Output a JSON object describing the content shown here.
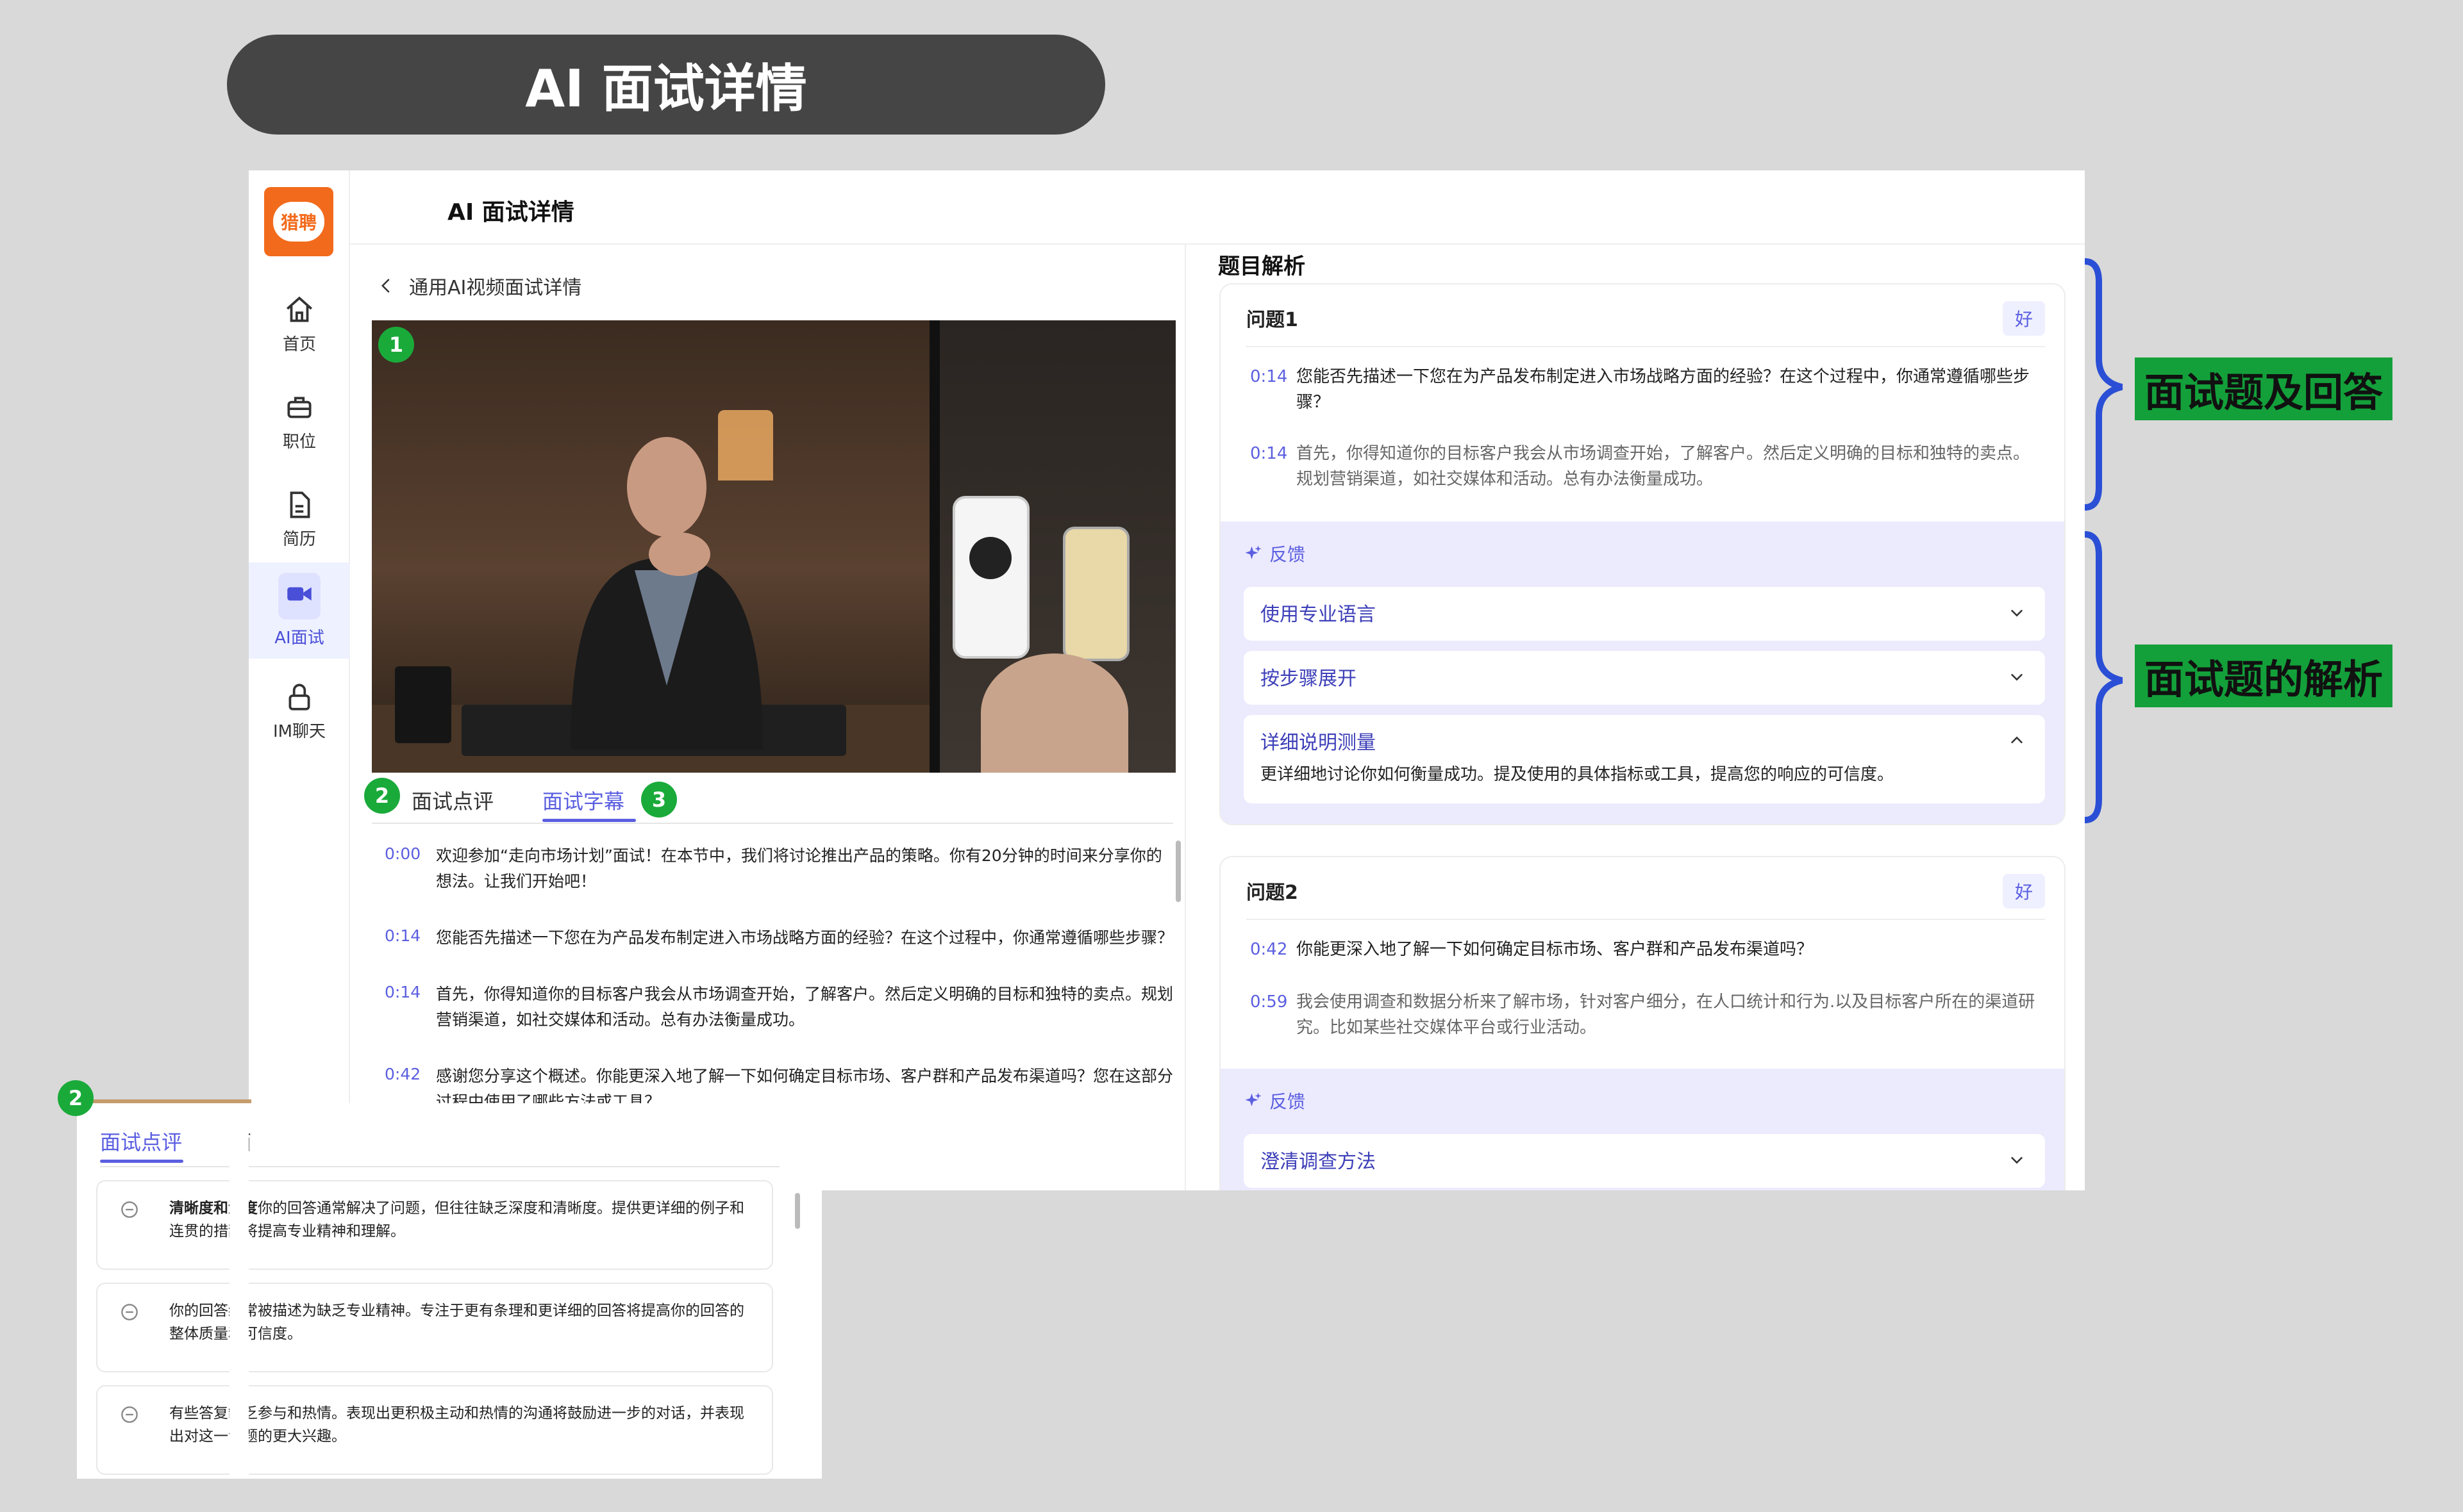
{
  "banner": {
    "title": "AI 面试详情"
  },
  "app": {
    "logo_text": "猎聘",
    "header_title": "AI 面试详情",
    "nav": [
      {
        "label": "首页",
        "icon": "home-icon"
      },
      {
        "label": "职位",
        "icon": "briefcase-icon"
      },
      {
        "label": "简历",
        "icon": "document-icon"
      },
      {
        "label": "AI面试",
        "icon": "video-camera-icon",
        "active": true
      },
      {
        "label": "IM聊天",
        "icon": "lock-icon"
      }
    ]
  },
  "left": {
    "back_label": "通用AI视频面试详情",
    "badges": {
      "video": "1",
      "tab_left": "2",
      "tab_right": "3"
    },
    "tabs": {
      "review": "面试点评",
      "subtitles": "面试字幕",
      "active": "subtitles"
    },
    "transcript": [
      {
        "time": "0:00",
        "text": "欢迎参加“走向市场计划”面试！在本节中，我们将讨论推出产品的策略。你有20分钟的时间来分享你的想法。让我们开始吧！"
      },
      {
        "time": "0:14",
        "text": "您能否先描述一下您在为产品发布制定进入市场战略方面的经验？在这个过程中，你通常遵循哪些步骤？"
      },
      {
        "time": "0:14",
        "text": "首先，你得知道你的目标客户我会从市场调查开始，了解客户。然后定义明确的目标和独特的卖点。规划营销渠道，如社交媒体和活动。总有办法衡量成功。"
      },
      {
        "time": "0:42",
        "text": "感谢您分享这个概述。你能更深入地了解一下如何确定目标市场、客户群和产品发布渠道吗？您在这部分过程中使用了哪些方法或工具？"
      }
    ]
  },
  "right": {
    "section_title": "题目解析",
    "feedback_label": "反馈",
    "questions": [
      {
        "title": "问题1",
        "tag": "好",
        "q_time": "0:14",
        "q_text": "您能否先描述一下您在为产品发布制定进入市场战略方面的经验？在这个过程中，你通常遵循哪些步骤？",
        "a_time": "0:14",
        "a_text": "首先，你得知道你的目标客户我会从市场调查开始，了解客户。然后定义明确的目标和独特的卖点。规划营销渠道，如社交媒体和活动。总有办法衡量成功。",
        "feedback": [
          {
            "label": "使用专业语言",
            "expanded": false
          },
          {
            "label": "按步骤展开",
            "expanded": false
          },
          {
            "label": "详细说明测量",
            "expanded": true,
            "desc": "更详细地讨论你如何衡量成功。提及使用的具体指标或工具，提高您的响应的可信度。"
          }
        ]
      },
      {
        "title": "问题2",
        "tag": "好",
        "q_time": "0:42",
        "q_text": "你能更深入地了解一下如何确定目标市场、客户群和产品发布渠道吗？",
        "a_time": "0:59",
        "a_text": "我会使用调查和数据分析来了解市场，针对客户细分，在人口统计和行为.以及目标客户所在的渠道研究。比如某些社交媒体平台或行业活动。",
        "feedback": [
          {
            "label": "澄清调查方法",
            "expanded": false
          }
        ]
      }
    ]
  },
  "annotations": {
    "qa_label": "面试题及回答",
    "analysis_label": "面试题的解析"
  },
  "overlay": {
    "badge": "2",
    "tab_active": "面试点评",
    "tab_other": "面",
    "items": [
      {
        "bold": "清晰度和深度",
        "text": "你的回答通常解决了问题，但往往缺乏深度和清晰度。提供更详细的例子和连贯的措辞将提高专业精神和理解。"
      },
      {
        "bold": "",
        "text": "你的回答经常被描述为缺乏专业精神。专注于更有条理和更详细的回答将提高你的回答的整体质量和可信度。"
      },
      {
        "bold": "",
        "text": "有些答复缺乏参与和热情。表现出更积极主动和热情的沟通将鼓励进一步的对话，并表现出对这一专题的更大兴趣。"
      }
    ]
  },
  "colors": {
    "accent": "#5b5fe0",
    "brand": "#f26a1b",
    "annotation_green": "#13a03a",
    "annotation_blue": "#2a4fd6"
  }
}
